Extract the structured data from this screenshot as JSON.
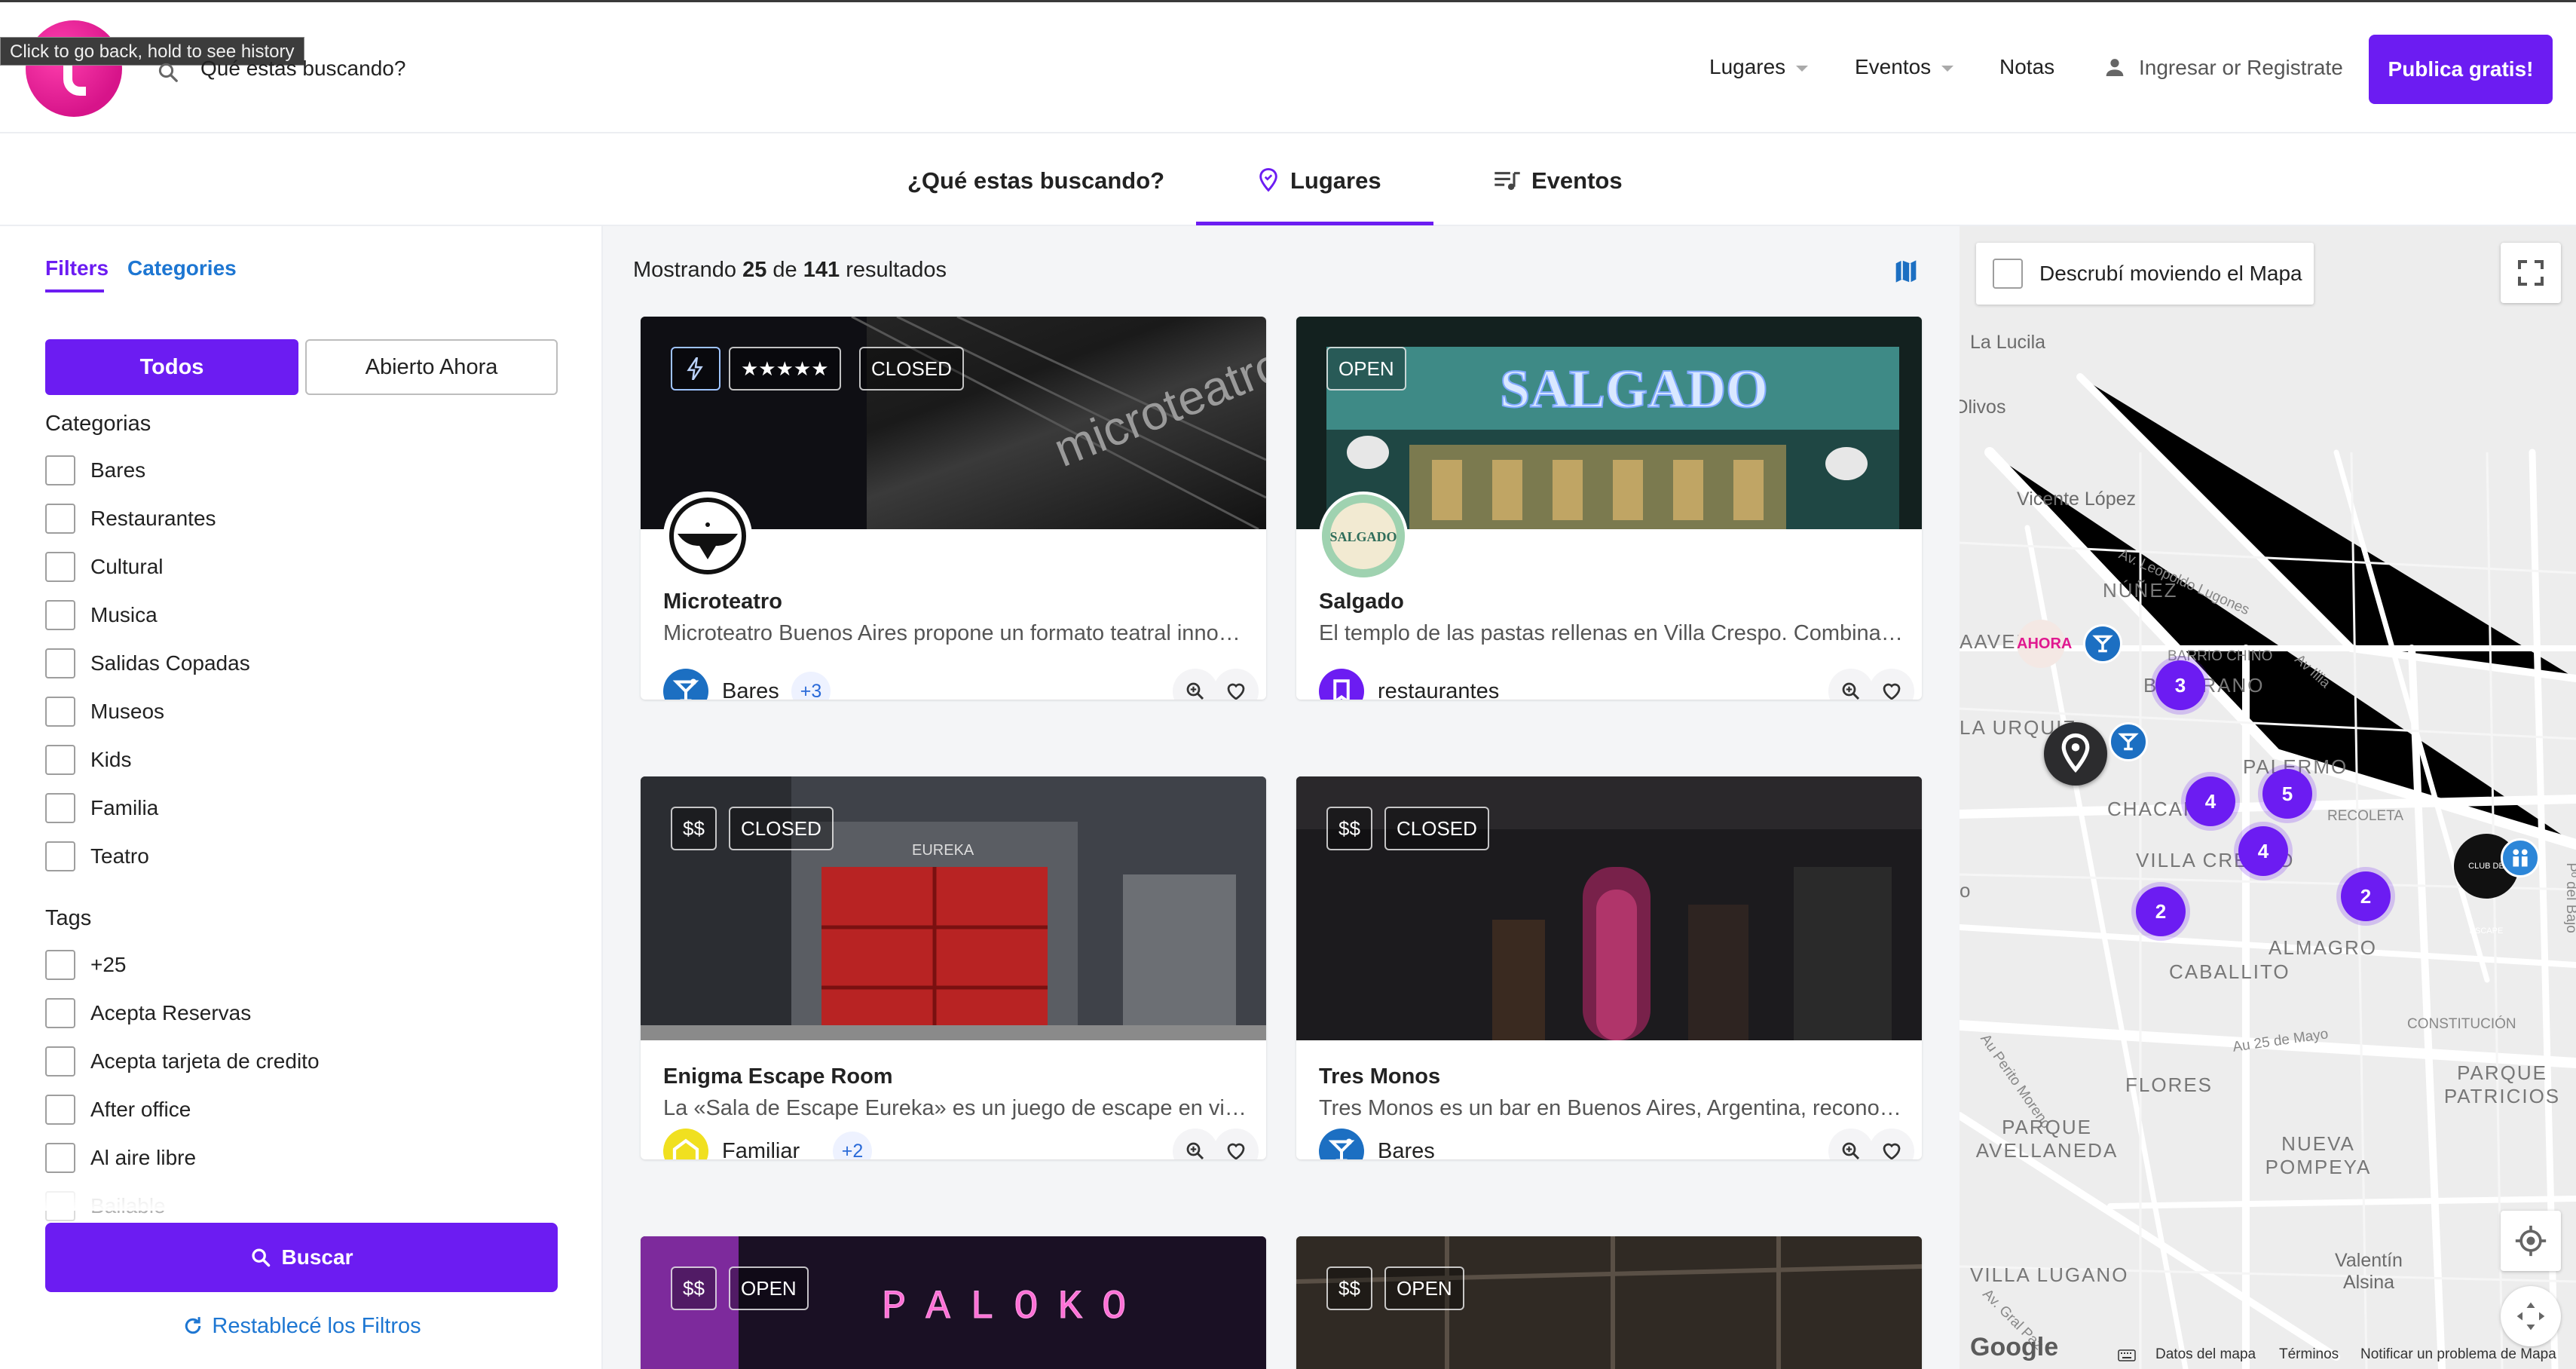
{
  "browser": {
    "back_tooltip": "Click to go back, hold to see history"
  },
  "header": {
    "search_placeholder": "Qué estas buscando?",
    "nav": {
      "lugares": "Lugares",
      "eventos": "Eventos",
      "notas": "Notas",
      "login": "Ingresar or Registrate"
    },
    "cta": "Publica gratis!"
  },
  "subnav": {
    "question": "¿Qué estas buscando?",
    "tab_lugares": "Lugares",
    "tab_eventos": "Eventos",
    "active": "Lugares"
  },
  "sidebar": {
    "tabs": {
      "filters": "Filters",
      "categories": "Categories"
    },
    "toggle": {
      "all": "Todos",
      "open_now": "Abierto Ahora"
    },
    "categories_title": "Categorias",
    "categories": [
      "Bares",
      "Restaurantes",
      "Cultural",
      "Musica",
      "Salidas Copadas",
      "Museos",
      "Kids",
      "Familia",
      "Teatro"
    ],
    "tags_title": "Tags",
    "tags": [
      "+25",
      "Acepta Reservas",
      "Acepta tarjeta de credito",
      "After office",
      "Al aire libre",
      "Bailable"
    ],
    "search_button": "Buscar",
    "reset_link": "Restablecé los Filtros"
  },
  "results": {
    "prefix": "Mostrando",
    "shown": "25",
    "of_label": "de",
    "total": "141",
    "suffix": "resultados",
    "cards": [
      {
        "badges": [
          "★★★★★",
          "CLOSED"
        ],
        "title": "Microteatro",
        "description": "Microteatro Buenos Aires propone un formato teatral innovador…",
        "category": "Bares",
        "extra": "+3",
        "category_color": "#1c6fc2",
        "category_icon": "cocktail-icon"
      },
      {
        "badges": [
          "OPEN"
        ],
        "title": "Salgado",
        "description": "El templo de las pastas rellenas en Villa Crespo. Combinación de…",
        "category": "restaurantes",
        "extra": "",
        "category_color": "#6c1cf2",
        "category_icon": "bookmark-icon"
      },
      {
        "badges": [
          "$$",
          "CLOSED"
        ],
        "title": "Enigma Escape Room",
        "description": "La «Sala de Escape Eureka» es un juego de escape en vivo (…",
        "category": "Familiar",
        "extra": "+2",
        "category_color": "#f0e020",
        "category_icon": "house-icon"
      },
      {
        "badges": [
          "$$",
          "CLOSED"
        ],
        "title": "Tres Monos",
        "description": "Tres Monos es un bar en Buenos Aires, Argentina, reconocido…",
        "category": "Bares",
        "extra": "",
        "category_color": "#1c6fc2",
        "category_icon": "cocktail-icon"
      },
      {
        "badges": [
          "$$",
          "OPEN"
        ],
        "sign": "PALOKO"
      },
      {
        "badges": [
          "$$",
          "OPEN"
        ]
      }
    ],
    "card_image_text": {
      "microteatro": "microteatro",
      "salgado": "SALGADO",
      "salgado_logo": "SALGADO",
      "eureka": "EUREKA"
    }
  },
  "map": {
    "discover_label": "Descrubí moviendo el Mapa",
    "labels": {
      "la_lucila": "La Lucila",
      "olivos": "Olivos",
      "vicente_lopez": "Vicente López",
      "av_lugones": "Av. Leopoldo Lugones",
      "nunez": "NÚÑEZ",
      "saavedra": "AAVED",
      "barrio_chino": "BARRIO CHINO",
      "belgrano": "BELGRANO",
      "la_urquiza": "LA URQUIZ",
      "av_illia": "Av Illia",
      "palermo": "PALERMO",
      "recoleta": "RECOLETA",
      "chacarita": "CHACARITA",
      "villa_crespo": "VILLA CRESPO",
      "almagro": "ALMAGRO",
      "caballito": "CABALLITO",
      "av_25_mayo": "Au 25 de Mayo",
      "constitucion": "CONSTITUCIÓN",
      "flores": "FLORES",
      "parque_patricios": "PARQUE PATRICIOS",
      "parque_avellaneda": "PARQUE AVELLANEDA",
      "nueva_pompeya": "NUEVA POMPEYA",
      "villa_lugano": "VILLA LUGANO",
      "valentin_alsina": "Valentín Alsina",
      "perito_moreno": "Au Perito Moreno",
      "paseo_bajo": "Pº del Bajo",
      "gral_paz": "Av. Gral Paz",
      "o_left": "o",
      "ahora_pin": "AHORA",
      "club_pin": "CLUB DE ESCAPE"
    },
    "clusters": [
      "3",
      "4",
      "5",
      "4",
      "2",
      "2"
    ],
    "footer": {
      "data": "Datos del mapa",
      "terms": "Términos",
      "report": "Notificar un problema de Mapa"
    },
    "logo": "Google"
  },
  "colors": {
    "accent": "#6c1cf2",
    "link": "#1d76d2",
    "brand_pink": "#e0188f"
  }
}
